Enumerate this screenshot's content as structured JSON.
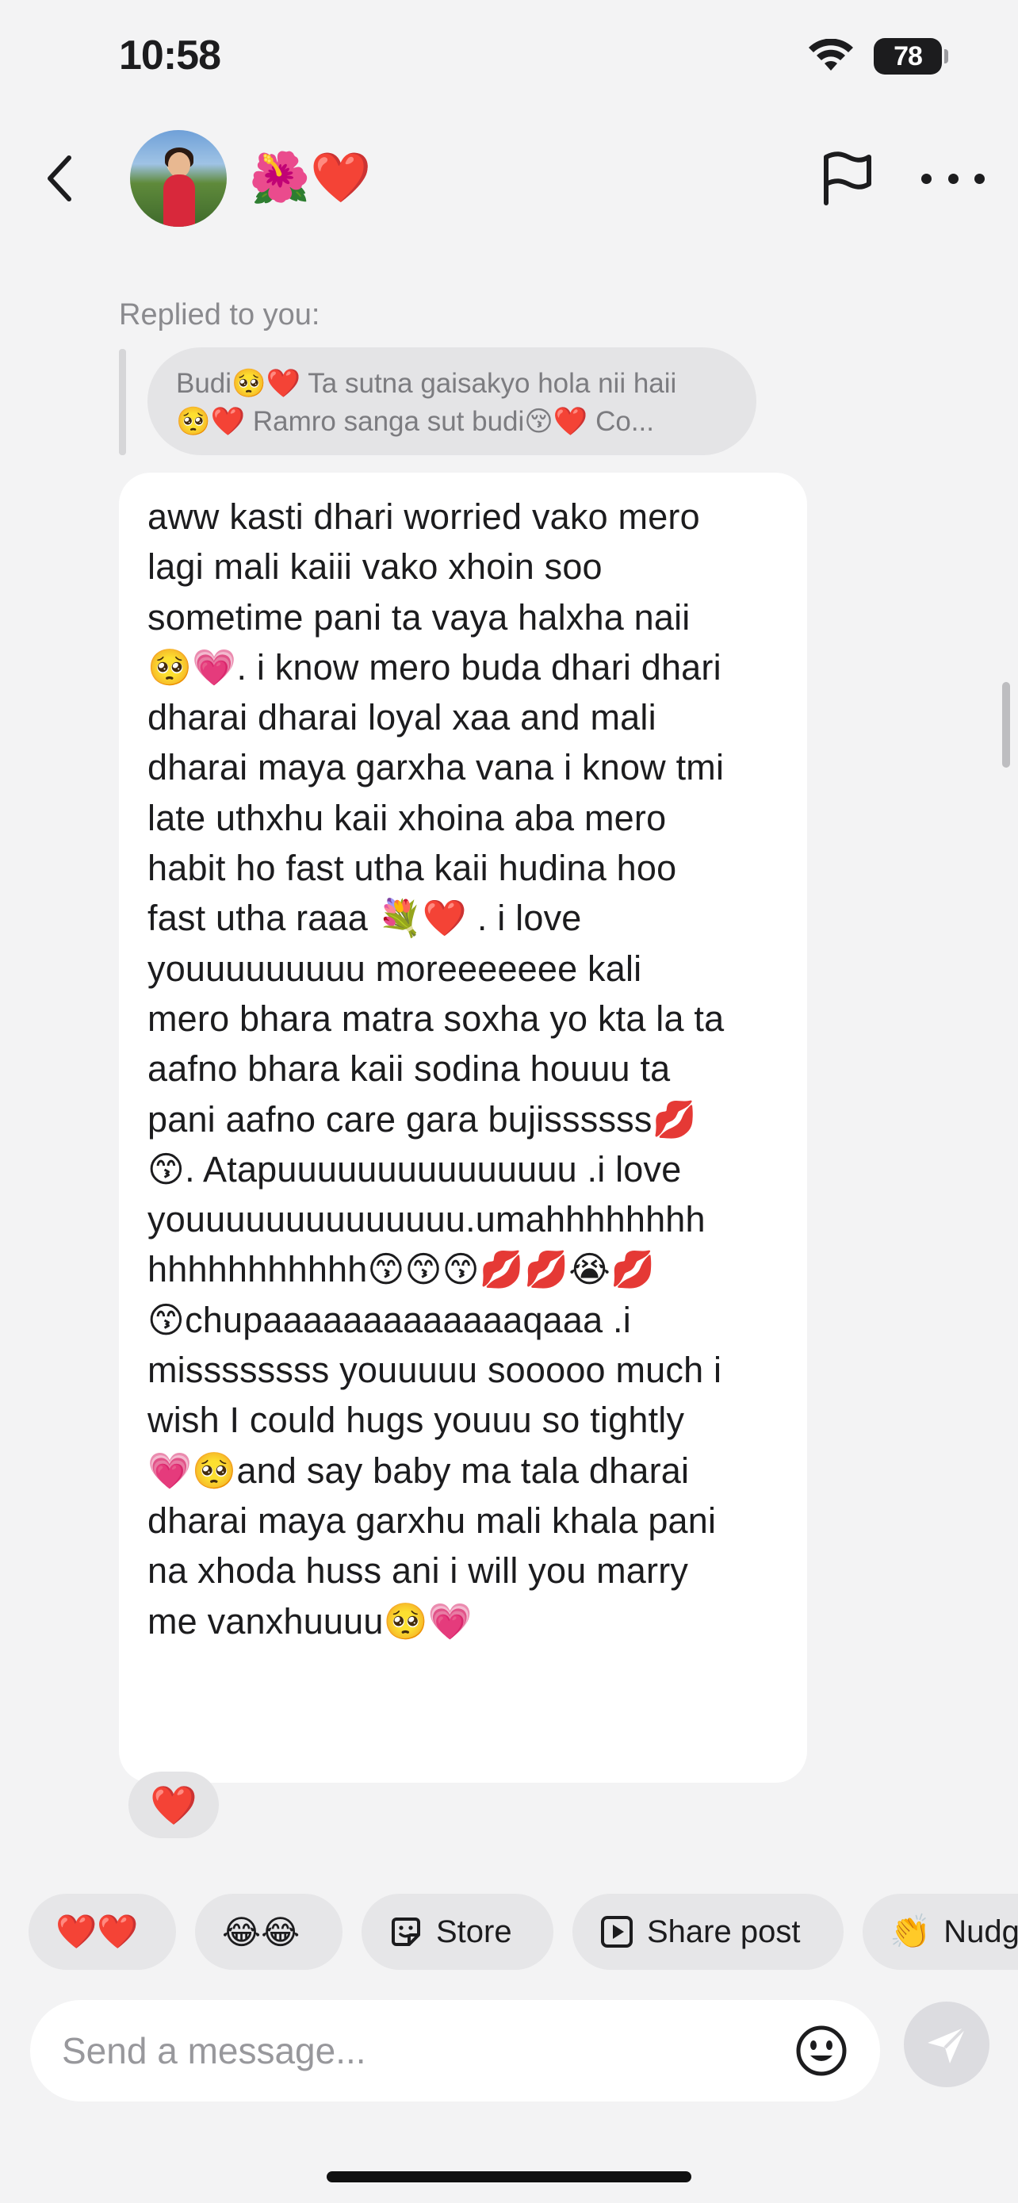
{
  "status_bar": {
    "time": "10:58",
    "battery": "78"
  },
  "header": {
    "name": "🌺❤️"
  },
  "reply": {
    "label": "Replied to you:",
    "quote_lines": [
      "Budi🥺❤️ Ta sutna gaisakyo hola nii haii",
      "🥺❤️ Ramro sanga sut budi😚❤️ Co..."
    ]
  },
  "message": {
    "lines": [
      "aww kasti dhari worried vako mero",
      "lagi mali kaiii vako xhoin soo",
      "sometime pani ta vaya halxha naii",
      "🥺💗. i know mero buda dhari dhari",
      "dharai dharai loyal xaa and mali",
      "dharai maya garxha vana i know tmi",
      "late uthxhu kaii xhoina aba mero",
      "habit ho fast utha kaii hudina hoo",
      "fast utha raaa 💐❤️ . i love",
      "youuuuuuuuu moreeeeeee kali",
      "mero bhara matra soxha yo kta la ta",
      "aafno bhara kaii sodina houuu ta",
      "pani aafno care gara bujissssss💋",
      "😙. Atapuuuuuuuuuuuuuuu .i love",
      "youuuuuuuuuuuuuu.umahhhhhhhh",
      "hhhhhhhhhhh😙😙😙💋💋😭💋",
      "😙chupaaaaaaaaaaaaaqaaa .i",
      "missssssss youuuuu sooooo much i",
      "wish I could hugs youuu so tightly",
      "💗🥺and say baby ma tala dharai",
      "dharai maya garxhu mali khala pani",
      "na xhoda huss ani i will you marry",
      "me vanxhuuuu🥺💗"
    ],
    "reaction": "❤️"
  },
  "quick_replies": [
    {
      "emoji": "❤️❤️",
      "label": ""
    },
    {
      "emoji": "😂😂",
      "label": ""
    },
    {
      "icon": "sticker-icon",
      "label": "Store"
    },
    {
      "icon": "play-icon",
      "label": "Share post"
    },
    {
      "emoji": "👏",
      "label": "Nudg"
    }
  ],
  "composer": {
    "placeholder": "Send a message..."
  },
  "colors": {
    "background": "#f3f3f4",
    "bubble": "#ffffff",
    "chip": "#e6e6e8",
    "muted": "#8a8a8e"
  }
}
